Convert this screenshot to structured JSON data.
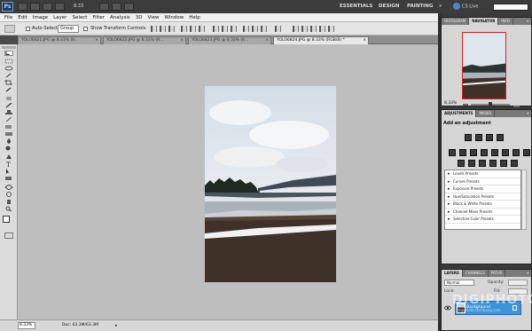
{
  "app": {
    "logo": "Ps",
    "zoom": "8.33",
    "workspaces": [
      "ESSENTIALS",
      "DESIGN",
      "PAINTING"
    ],
    "workspace_more": "»",
    "cs_live": "CS Live"
  },
  "menu": [
    "File",
    "Edit",
    "Image",
    "Layer",
    "Select",
    "Filter",
    "Analysis",
    "3D",
    "View",
    "Window",
    "Help"
  ],
  "options": {
    "auto_select_label": "Auto-Select:",
    "auto_select_value": "Group",
    "show_transform_label": "Show Transform Controls"
  },
  "tabs": [
    {
      "label": "YOLO6821.JPG @ 8.33% (R...",
      "active": false
    },
    {
      "label": "YOLO6822.JPG @ 8.33% (R...",
      "active": false
    },
    {
      "label": "YOLO6823.JPG @ 8.33% (R...",
      "active": false
    },
    {
      "label": "YOLO6824.JPG @ 8.33% (RGB/8) *",
      "active": true
    }
  ],
  "status": {
    "zoom": "8.33%",
    "doc": "Doc: 63.3M/63.3M"
  },
  "navigator": {
    "tabs": [
      "HISTOGRAM",
      "NAVIGATOR",
      "INFO"
    ],
    "active_tab": "NAVIGATOR",
    "zoom": "8.33%"
  },
  "adjustments": {
    "tabs": [
      "ADJUSTMENTS",
      "MASKS"
    ],
    "active_tab": "ADJUSTMENTS",
    "title": "Add an adjustment",
    "presets": [
      "Levels Presets",
      "Curves Presets",
      "Exposure Presets",
      "Hue/Saturation Presets",
      "Black & White Presets",
      "Channel Mixer Presets",
      "Selective Color Presets"
    ]
  },
  "layers": {
    "tabs": [
      "LAYERS",
      "CHANNELS",
      "PATHS"
    ],
    "active_tab": "LAYERS",
    "blend_mode": "Normal",
    "opacity_label": "Opacity:",
    "fill_label": "Fill:",
    "lock_label": "Lock:",
    "layer_name": "Background"
  },
  "watermark": {
    "text": "DIGIPHOTO",
    "sub": "digiphoto.techbang.com"
  },
  "colors": {
    "accent": "#3e94d8",
    "canvas": "#bebebe",
    "appbar": "#3c3c3c"
  }
}
